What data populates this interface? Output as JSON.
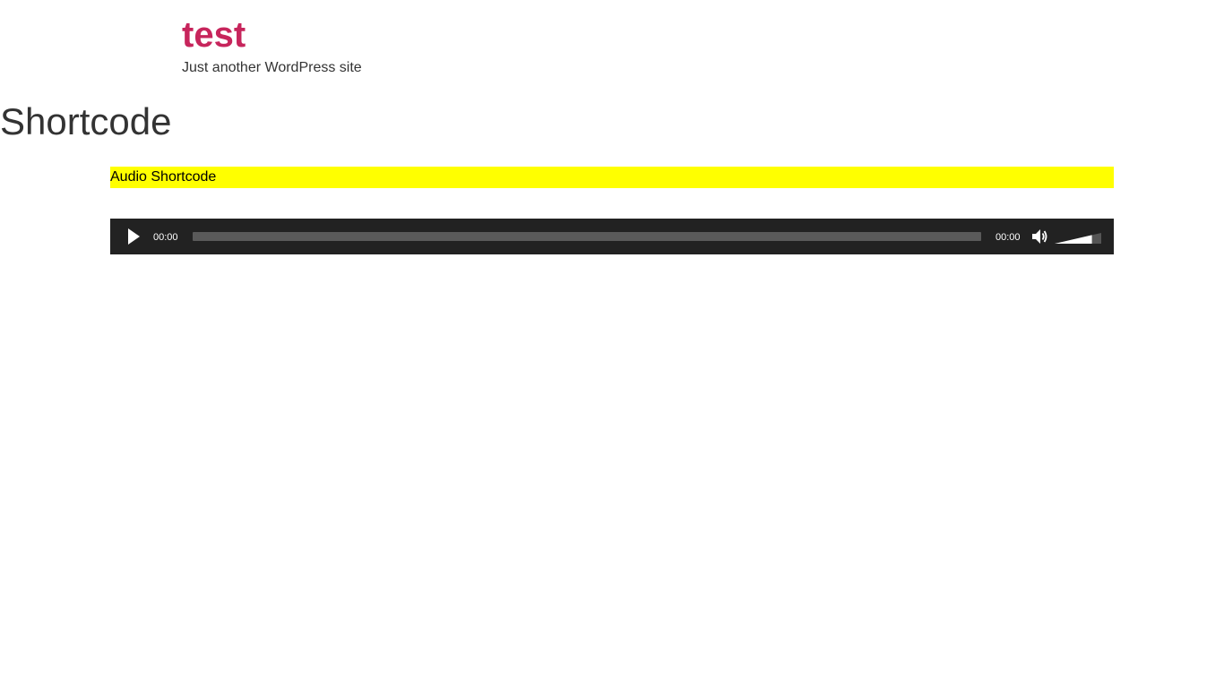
{
  "site": {
    "title": "test",
    "tagline": "Just another WordPress site"
  },
  "page": {
    "title": "Shortcode"
  },
  "content": {
    "highlight_text": "Audio Shortcode",
    "highlight_color": "#ffff00"
  },
  "player": {
    "current_time": "00:00",
    "duration": "00:00",
    "progress_fraction": 0,
    "volume_fraction": 0.8,
    "play_icon": "play-icon",
    "mute_icon": "speaker-icon",
    "background_color": "#222222"
  },
  "colors": {
    "title_accent": "#c7255c",
    "text": "#333333"
  }
}
